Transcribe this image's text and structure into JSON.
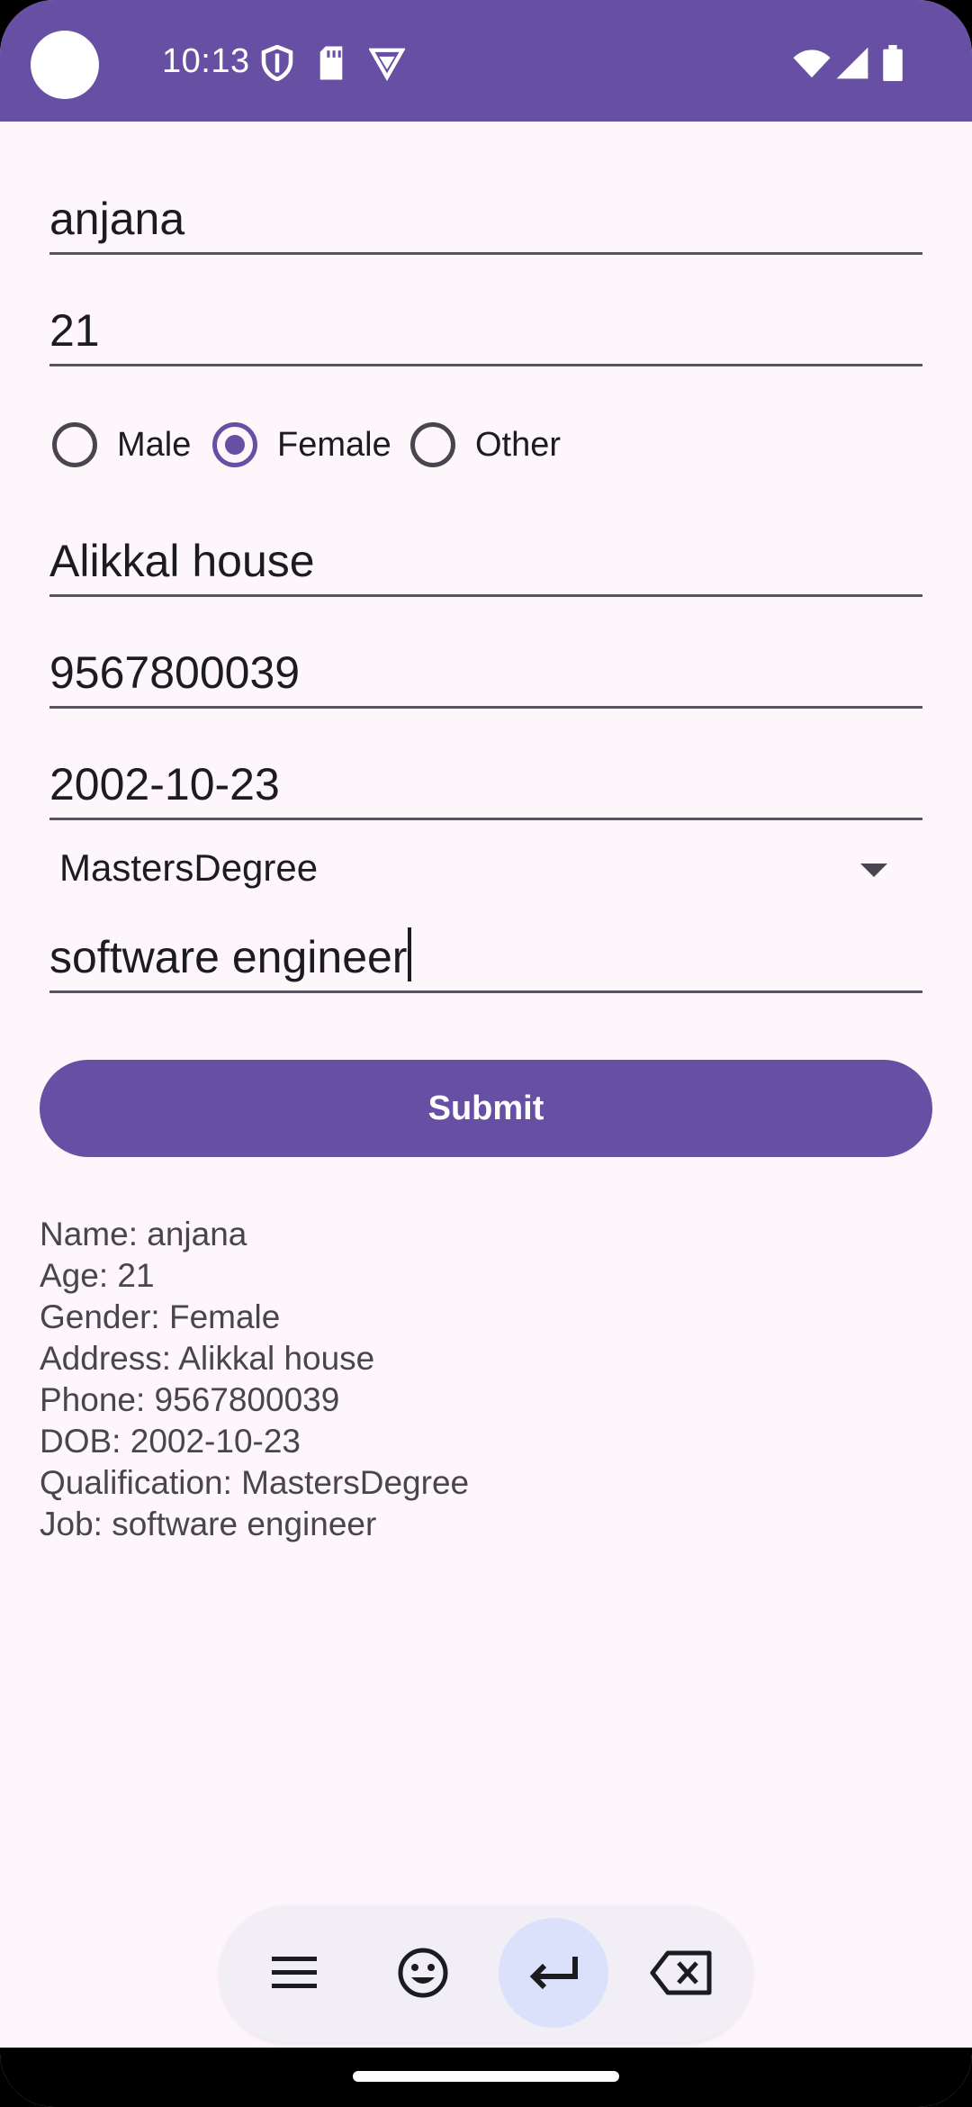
{
  "status_bar": {
    "time": "10:13",
    "icons": [
      "shield-icon",
      "sd-card-icon",
      "vpn-icon",
      "wifi-icon",
      "signal-icon",
      "battery-icon"
    ],
    "color": "#674fa3"
  },
  "form": {
    "name": "anjana",
    "age": "21",
    "gender_options": [
      "Male",
      "Female",
      "Other"
    ],
    "gender_selected": "Female",
    "address": "Alikkal house",
    "phone": "9567800039",
    "dob": "2002-10-23",
    "qualification": "MastersDegree",
    "job": "software engineer",
    "submit_label": "Submit"
  },
  "result": {
    "lines": [
      "Name: anjana",
      "Age: 21",
      "Gender: Female",
      "Address: Alikkal house",
      "Phone: 9567800039",
      "DOB: 2002-10-23",
      "Qualification: MastersDegree",
      "Job: software engineer"
    ]
  },
  "keyboard_toolbar": {
    "buttons": [
      "menu-icon",
      "emoji-icon",
      "enter-icon",
      "backspace-icon"
    ],
    "active": "enter-icon"
  },
  "colors": {
    "accent": "#674fa3",
    "background": "#fdf6fb"
  }
}
